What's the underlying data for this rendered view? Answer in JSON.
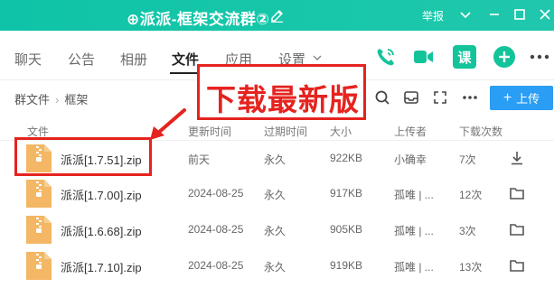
{
  "window": {
    "title": "⊕派派-框架交流群②",
    "report_label": "举报"
  },
  "tabs": [
    {
      "label": "聊天"
    },
    {
      "label": "公告"
    },
    {
      "label": "相册"
    },
    {
      "label": "文件"
    },
    {
      "label": "应用"
    },
    {
      "label": "设置"
    }
  ],
  "active_tab": "文件",
  "quick_actions": {
    "course_label": "课"
  },
  "breadcrumb": {
    "root": "群文件",
    "current": "框架"
  },
  "toolbar": {
    "upload_label": "上传"
  },
  "table": {
    "headers": [
      "文件",
      "更新时间",
      "过期时间",
      "大小",
      "上传者",
      "下载次数"
    ],
    "rows": [
      {
        "name": "派派[1.7.51].zip",
        "updated": "前天",
        "expires": "永久",
        "size": "922KB",
        "uploader": "小确幸",
        "downloads": "7次",
        "action": "download-icon"
      },
      {
        "name": "派派[1.7.00].zip",
        "updated": "2024-08-25",
        "expires": "永久",
        "size": "917KB",
        "uploader": "孤唯 | ...",
        "downloads": "12次",
        "action": "folder-icon"
      },
      {
        "name": "派派[1.6.68].zip",
        "updated": "2024-08-25",
        "expires": "永久",
        "size": "905KB",
        "uploader": "孤唯 | ...",
        "downloads": "3次",
        "action": "folder-icon"
      },
      {
        "name": "派派[1.7.10].zip",
        "updated": "2024-08-25",
        "expires": "永久",
        "size": "919KB",
        "uploader": "孤唯 | ...",
        "downloads": "13次",
        "action": "folder-icon"
      }
    ]
  },
  "annotation": {
    "text": "下载最新版",
    "color": "#e5231f"
  },
  "colors": {
    "titlebar": "#18c7a9",
    "accent_green": "#13c39a",
    "upload_blue": "#2a9df4",
    "zip_orange": "#f3b765"
  }
}
